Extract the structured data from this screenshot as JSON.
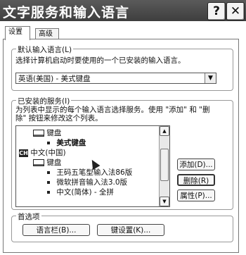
{
  "window": {
    "title": "文字服务和输入语言",
    "help_button": "?",
    "close_button": "✕"
  },
  "tabs": [
    {
      "label": "设置",
      "active": true
    },
    {
      "label": "高级",
      "active": false
    }
  ],
  "default_language": {
    "group_title": "默认输入语言(L)",
    "description": "选择计算机启动时要使用的一个已安装的输入语言。",
    "selected": "英语(美国) - 美式键盘",
    "dropdown_arrow": "▼"
  },
  "installed_services": {
    "group_title": "已安装的服务(I)",
    "description_line1": "为列表中显示的每个输入语言选择服务。使用 \"添加\" 和 \"删",
    "description_line2": "除\" 按钮来修改这个列表。",
    "items": [
      {
        "kind": "category",
        "label": "键盘"
      },
      {
        "kind": "service",
        "label": "美式键盘"
      },
      {
        "kind": "language",
        "code": "CH",
        "label": "中文(中国)"
      },
      {
        "kind": "category",
        "label": "键盘"
      },
      {
        "kind": "service",
        "label": "王码五笔型输入法86版"
      },
      {
        "kind": "service",
        "label": "微软拼音输入法3.0版"
      },
      {
        "kind": "service",
        "label": "中文(简体) - 全拼"
      }
    ],
    "buttons": {
      "add": "添加(D)...",
      "remove": "删除(R)",
      "properties": "属性(P)..."
    }
  },
  "preferences": {
    "group_title": "首选项",
    "language_bar": "语言栏(B)...",
    "key_settings": "键设置(K)..."
  },
  "colors": {
    "titlebar": "#4a4a4a",
    "background": "#ffffff"
  }
}
